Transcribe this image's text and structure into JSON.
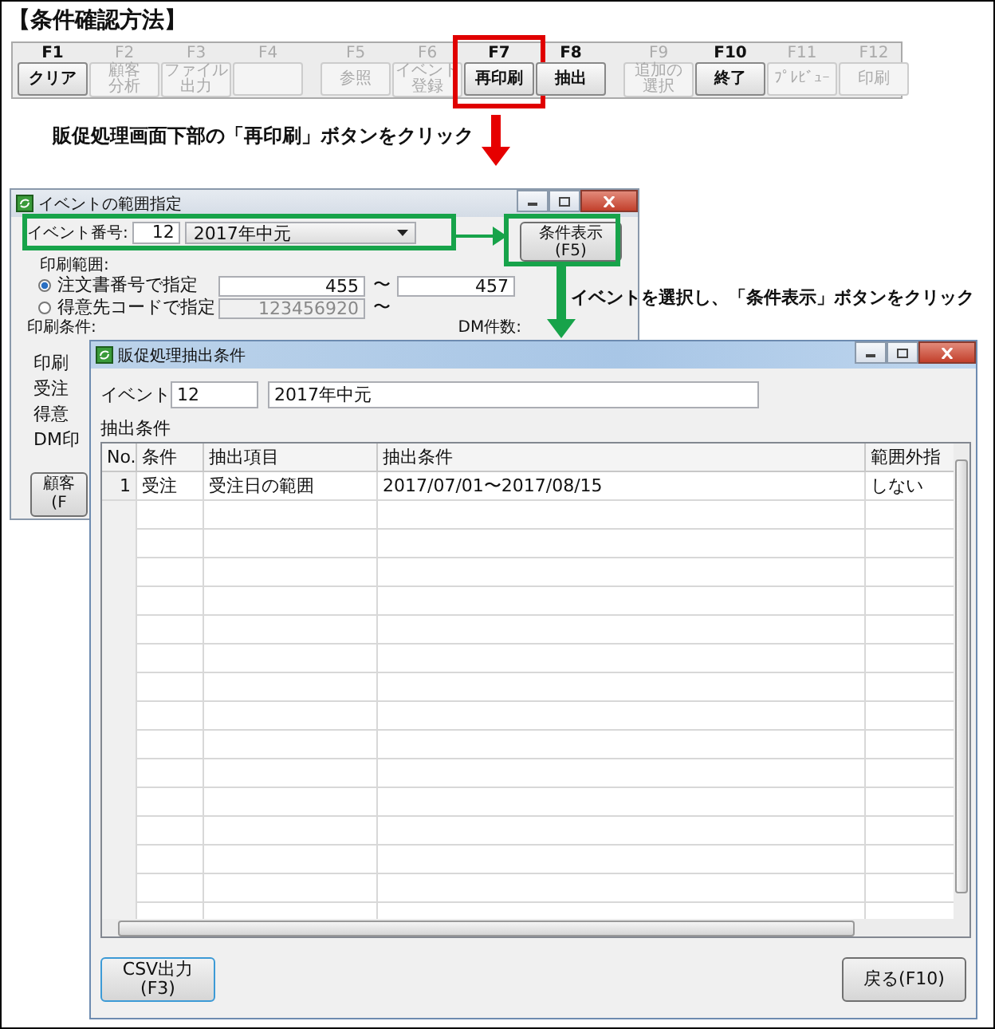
{
  "heading": "【条件確認方法】",
  "function_bar": {
    "groups": [
      [
        {
          "key": "F1",
          "label": [
            "クリア"
          ],
          "enabled": true,
          "highlighted": false
        },
        {
          "key": "F2",
          "label": [
            "顧客",
            "分析"
          ],
          "enabled": false,
          "highlighted": false
        },
        {
          "key": "F3",
          "label": [
            "ファイル",
            "出力"
          ],
          "enabled": false,
          "highlighted": false
        },
        {
          "key": "F4",
          "enabled": false,
          "highlighted": false
        }
      ],
      [
        {
          "key": "F5",
          "label": [
            "参照"
          ],
          "enabled": false,
          "highlighted": false
        },
        {
          "key": "F6",
          "label": [
            "イベント",
            "登録"
          ],
          "enabled": false,
          "highlighted": false
        },
        {
          "key": "F7",
          "label": [
            "再印刷"
          ],
          "enabled": true,
          "highlighted": true
        },
        {
          "key": "F8",
          "label": [
            "抽出"
          ],
          "enabled": true,
          "highlighted": false
        }
      ],
      [
        {
          "key": "F9",
          "label": [
            "追加の",
            "選択"
          ],
          "enabled": false,
          "highlighted": false
        },
        {
          "key": "F10",
          "label": [
            "終了"
          ],
          "enabled": true,
          "highlighted": false
        },
        {
          "key": "F11",
          "label": [
            "ﾌﾟﾚﾋﾞｭｰ"
          ],
          "enabled": false,
          "highlighted": false
        },
        {
          "key": "F12",
          "label": [
            "印刷"
          ],
          "enabled": false,
          "highlighted": false
        }
      ]
    ]
  },
  "step_1": "販促処理画面下部の「再印刷」ボタンをクリック",
  "step_2": "イベントを選択し、「条件表示」ボタンをクリック",
  "range_window": {
    "title": "イベントの範囲指定",
    "event_label": "イベント番号:",
    "event_number": "12",
    "event_name": "2017年中元",
    "show_button": [
      "条件表示",
      "(F5)"
    ],
    "range_label": "印刷範囲:",
    "options": [
      {
        "label": "注文書番号で指定",
        "selected": true,
        "from": "455",
        "separator": "〜",
        "to": "457"
      },
      {
        "label": "得意先コードで指定",
        "selected": false,
        "from": "123456920",
        "separator": "〜"
      }
    ],
    "conditions_label": "印刷条件:",
    "dm_count_label": "DM件数:",
    "condition_rows": [
      "印刷",
      "受注",
      "得意",
      "DM印"
    ],
    "customer_button": [
      "顧客",
      "(F"
    ]
  },
  "extract_window": {
    "title": "販促処理抽出条件",
    "event_label": "イベント",
    "event_number": "12",
    "event_name": "2017年中元",
    "section_label": "抽出条件",
    "columns": [
      "No.",
      "条件",
      "抽出項目",
      "抽出条件",
      "範囲外指"
    ],
    "rows": [
      [
        "1",
        "受注",
        "受注日の範囲",
        "2017/07/01〜2017/08/15",
        "しない"
      ]
    ],
    "csv_button": [
      "CSV出力",
      "(F3)"
    ],
    "back_button": "戻る(F10)"
  }
}
